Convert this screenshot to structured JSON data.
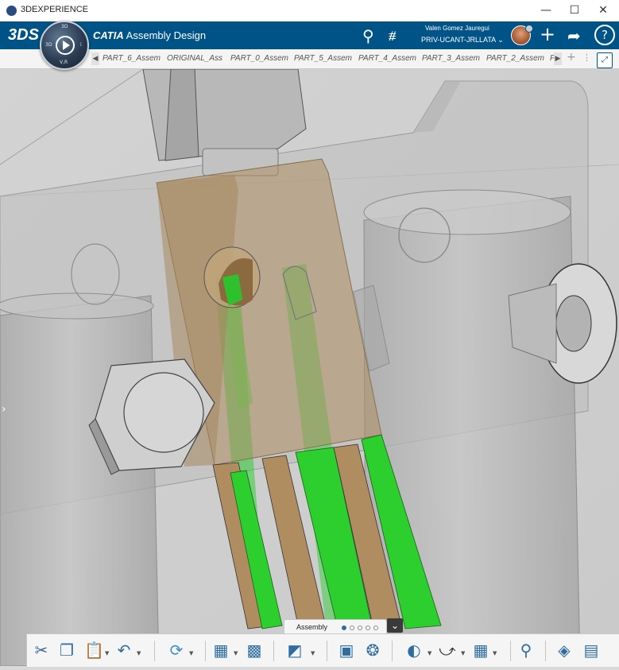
{
  "window": {
    "title": "3DEXPERIENCE",
    "minimize": "—",
    "maximize": "☐",
    "close": "✕"
  },
  "header": {
    "brand_bold": "CATIA",
    "app_name": "Assembly Design",
    "compass": {
      "top": "3D",
      "left": "3D",
      "right": "i",
      "bottom": "V,R"
    },
    "user": {
      "name": "Valen Gomez Jauregui",
      "tenant": "PRIV-UCANT-JRLLATA"
    },
    "icons": [
      "search-icon",
      "tag-icon",
      "add-icon",
      "share-icon",
      "help-icon"
    ]
  },
  "tabs": [
    "PART_6_Assem",
    "ORIGINAL_Ass",
    "PART_0_Assem",
    "PART_5_Assem",
    "PART_4_Assem",
    "PART_3_Assem",
    "PART_2_Assem",
    "P"
  ],
  "action_bar": {
    "section_label": "Assembly",
    "section_page_count": 5,
    "active_page": 0
  },
  "colors": {
    "header_bg": "#005386",
    "part_grey": "#b8b8b8",
    "part_tan": "#ae8e62",
    "strip_green": "#1fcf2a"
  }
}
